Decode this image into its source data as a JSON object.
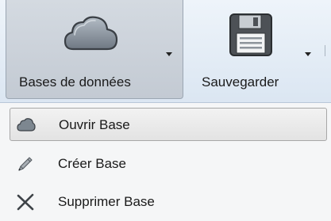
{
  "ribbon": {
    "databases": {
      "label": "Bases de données",
      "icon": "cloud-icon"
    },
    "save": {
      "label": "Sauvegarder",
      "icon": "floppy-disk-icon"
    }
  },
  "menu": {
    "items": [
      {
        "label": "Ouvrir Base",
        "icon": "cloud-icon"
      },
      {
        "label": "Créer Base",
        "icon": "pencil-icon"
      },
      {
        "label": "Supprimer Base",
        "icon": "delete-x-icon"
      }
    ]
  },
  "colors": {
    "ribbon_bg": "#e4edf6",
    "active_button_bg": "#cdd3da",
    "menu_hover_bg": "#ebebeb"
  }
}
